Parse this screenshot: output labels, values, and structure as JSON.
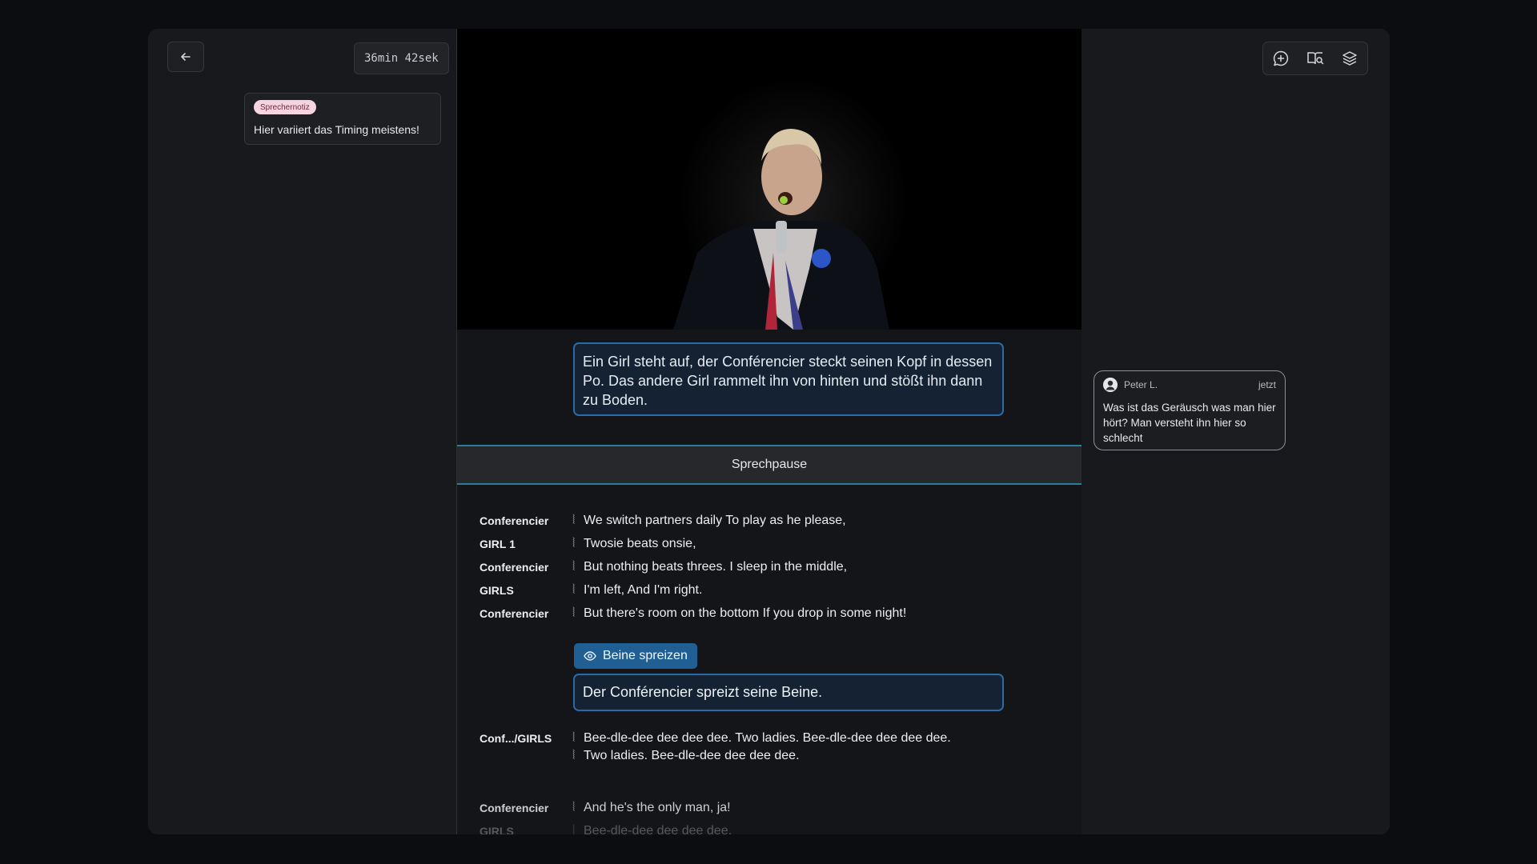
{
  "header": {
    "timer": "36min 42sek"
  },
  "note": {
    "tag": "Sprechernotiz",
    "text": "Hier variiert das Timing meistens!"
  },
  "narration": {
    "text": "Ein Girl steht auf, der Conférencier steckt seinen Kopf in dessen Po. Das andere Girl rammelt ihn von hinten und stößt ihn dann zu Boden."
  },
  "pause_label": "Sprechpause",
  "lines_top": [
    {
      "speaker": "Conferencier",
      "text": "We switch partners daily To play as he please,"
    },
    {
      "speaker": "GIRL 1",
      "text": "Twosie beats onsie,"
    },
    {
      "speaker": "Conferencier",
      "text": "But nothing beats threes. I sleep in the middle,"
    },
    {
      "speaker": "GIRLS",
      "text": "I'm left, And I'm right."
    },
    {
      "speaker": "Conferencier",
      "text": "But there's room on the bottom If you drop in some night!"
    }
  ],
  "action": {
    "label": "Beine spreizen",
    "description": "Der Conférencier spreizt seine Beine."
  },
  "lines_bottom": [
    {
      "speaker": "Conf.../GIRLS",
      "text": "Bee-dle-dee dee dee dee. Two ladies. Bee-dle-dee dee dee dee. Two ladies. Bee-dle-dee dee dee dee."
    },
    {
      "speaker": "Conferencier",
      "text": "And he's the only man, ja!"
    },
    {
      "speaker": "GIRLS",
      "text": "Bee-dle-dee dee dee dee."
    }
  ],
  "comment": {
    "author": "Peter L.",
    "time": "jetzt",
    "text": "Was ist das Geräusch was man hier hört? Man versteht ihn hier so schlecht"
  },
  "icons": {
    "back": "arrow-left-icon",
    "comment": "chat-plus-icon",
    "glossary": "book-search-icon",
    "layers": "layers-icon",
    "visibility": "eye-icon"
  }
}
